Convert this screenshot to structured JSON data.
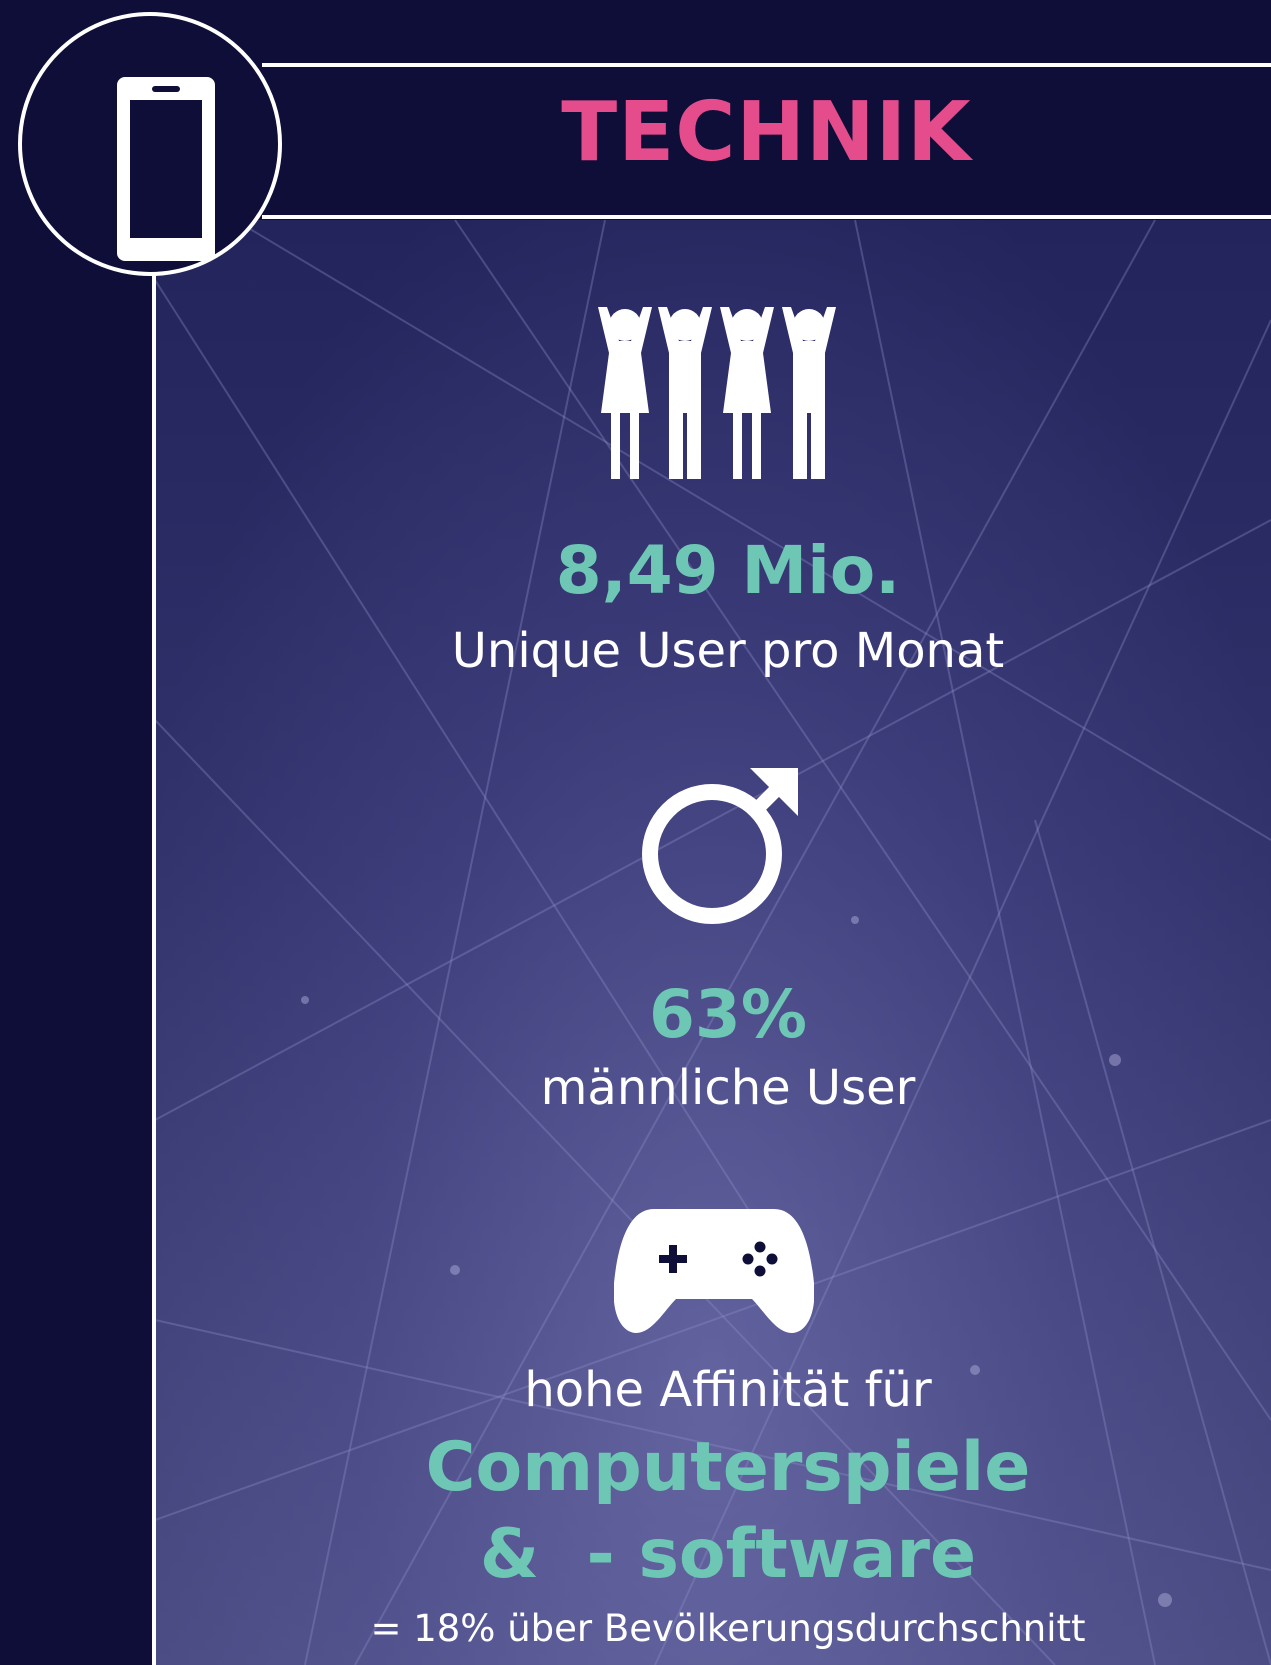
{
  "header": {
    "title": "TECHNIK",
    "title_color": "#e44c8c",
    "icon": "smartphone-icon"
  },
  "stats": [
    {
      "icon": "people-group-icon",
      "value": "8,49 Mio.",
      "label": "Unique User pro Monat"
    },
    {
      "icon": "male-symbol-icon",
      "value": "63%",
      "label": "männliche User"
    },
    {
      "icon": "gamepad-icon",
      "intro": "hohe Affinität für",
      "highlight_line1": "Computerspiele",
      "highlight_line2": "&  - software",
      "footnote": "= 18% über Bevölkerungsdurchschnitt"
    }
  ],
  "colors": {
    "background": "#0e0e38",
    "accent": "#6ec7b5",
    "text": "#ffffff"
  }
}
